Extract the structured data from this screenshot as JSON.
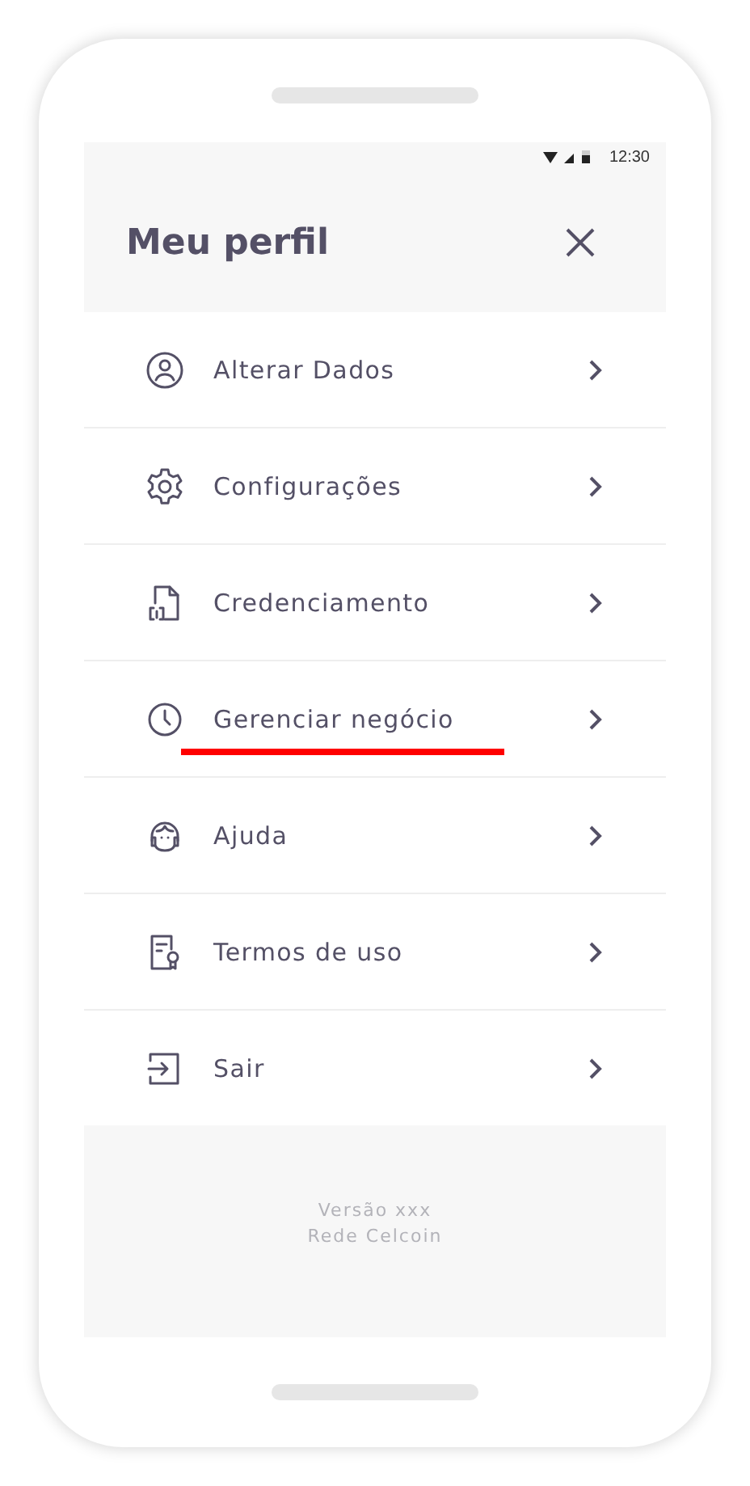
{
  "status_bar": {
    "time": "12:30"
  },
  "header": {
    "title": "Meu perfil"
  },
  "menu": [
    {
      "label": "Alterar Dados",
      "kind": "user",
      "underlined": false
    },
    {
      "label": "Configurações",
      "kind": "gear",
      "underlined": false
    },
    {
      "label": "Credenciamento",
      "kind": "document",
      "underlined": false
    },
    {
      "label": "Gerenciar negócio",
      "kind": "clock",
      "underlined": true
    },
    {
      "label": "Ajuda",
      "kind": "headset",
      "underlined": false
    },
    {
      "label": "Termos de uso",
      "kind": "certificate",
      "underlined": false
    },
    {
      "label": "Sair",
      "kind": "exit",
      "underlined": false
    }
  ],
  "footer": {
    "lines": [
      "Versão xxx",
      "Rede Celcoin"
    ]
  }
}
